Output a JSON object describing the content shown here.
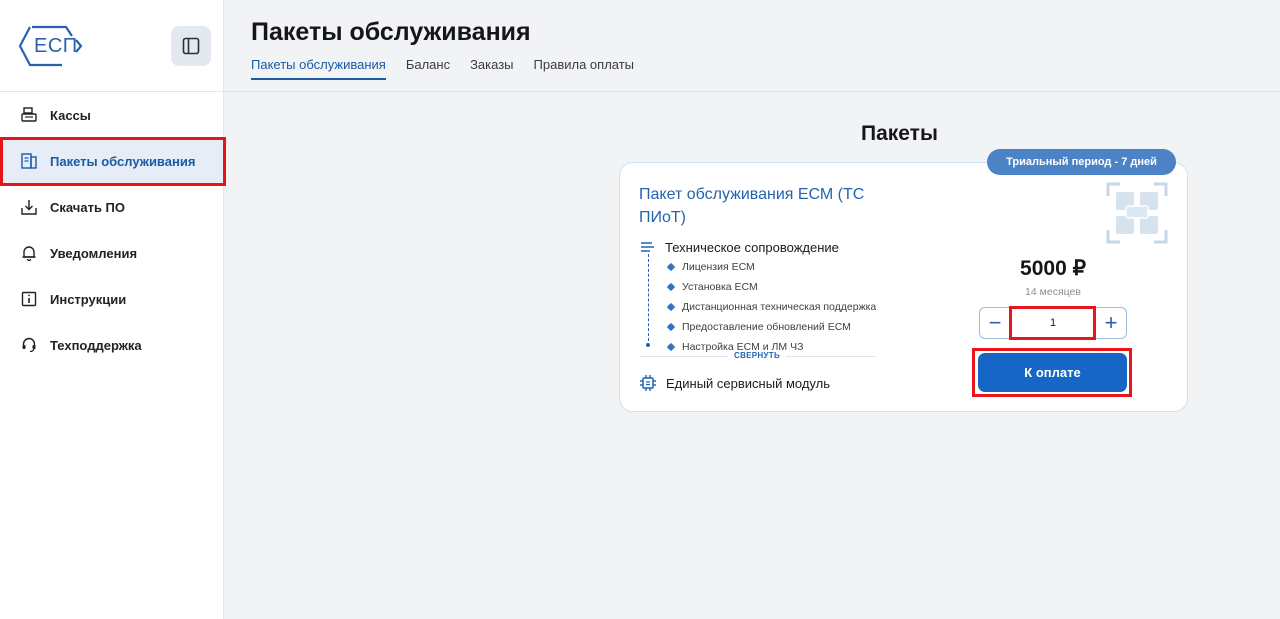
{
  "sidebar": {
    "logo_text": "ЕСП",
    "items": [
      {
        "label": "Кассы",
        "icon": "cash-register-icon"
      },
      {
        "label": "Пакеты обслуживания",
        "icon": "service-packages-icon"
      },
      {
        "label": "Скачать ПО",
        "icon": "download-icon"
      },
      {
        "label": "Уведомления",
        "icon": "bell-icon"
      },
      {
        "label": "Инструкции",
        "icon": "info-icon"
      },
      {
        "label": "Техподдержка",
        "icon": "headset-icon"
      }
    ]
  },
  "header": {
    "title": "Пакеты обслуживания",
    "tabs": [
      "Пакеты обслуживания",
      "Баланс",
      "Заказы",
      "Правила оплаты"
    ]
  },
  "main": {
    "section_title": "Пакеты",
    "package": {
      "badge": "Триальный период - 7 дней",
      "title": "Пакет обслуживания ЕСМ (ТС ПИоТ)",
      "tech_title": "Техническое сопровождение",
      "features": [
        "Лицензия ЕСМ",
        "Установка ЕСМ",
        "Дистанционная техническая поддержка",
        "Предоставление обновлений ЕСМ",
        "Настройка ЕСМ и ЛМ ЧЗ"
      ],
      "collapse_label": "СВЕРНУТЬ",
      "module_label": "Единый сервисный модуль",
      "price": "5000 ₽",
      "period": "14 месяцев",
      "quantity": "1",
      "minus": "−",
      "plus": "+",
      "pay_label": "К оплате"
    }
  },
  "colors": {
    "accent": "#1666c5",
    "highlight": "#e8141b",
    "badge": "#4c83c6"
  }
}
